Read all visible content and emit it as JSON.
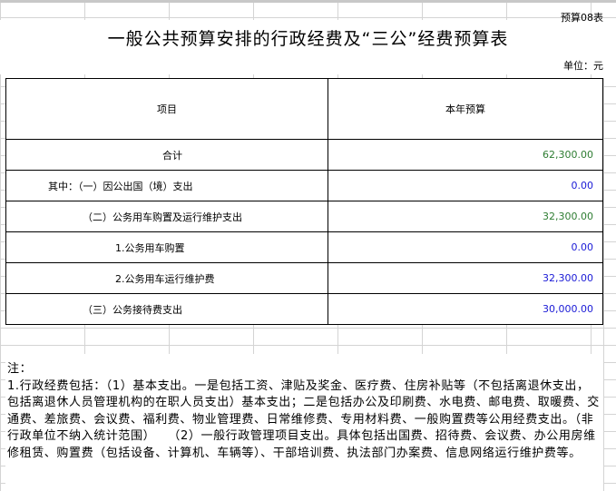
{
  "sheet": {
    "table_no": "预算08表",
    "title": "一般公共预算安排的行政经费及“三公”经费预算表",
    "unit": "单位：元"
  },
  "table": {
    "headers": [
      "项目",
      "本年预算"
    ],
    "rows": [
      {
        "label": "合计",
        "value": "62,300.00",
        "color": "#2e7d32"
      },
      {
        "label": "其中：（一）因公出国（境）支出",
        "value": "0.00",
        "color": "#1a1ad6"
      },
      {
        "label": "（二）公务用车购置及运行维护支出",
        "value": "32,300.00",
        "color": "#2e7d32"
      },
      {
        "label": "1.公务用车购置",
        "value": "0.00",
        "color": "#1a1ad6"
      },
      {
        "label": "2.公务用车运行维护费",
        "value": "32,300.00",
        "color": "#1a1ad6"
      },
      {
        "label": "（三）公务接待费支出",
        "value": "30,000.00",
        "color": "#1a1ad6"
      }
    ]
  },
  "notes": {
    "heading": "注：",
    "body": "1.行政经费包括：（1）基本支出。一是包括工资、津贴及奖金、医疗费、住房补贴等（不包括离退休支出，包括离退休人员管理机构的在职人员支出）基本支出；二是包括办公及印刷费、水电费、邮电费、取暖费、交通费、差旅费、会议费、福利费、物业管理费、日常维修费、专用材料费、一般购置费等公用经费支出。（非行政单位不纳入统计范围）　　（2）一般行政管理项目支出。具体包括出国费、招待费、会议费、办公用房维修租赁、购置费（包括设备、计算机、车辆等）、干部培训费、执法部门办案费、信息网络运行维护费等。"
  }
}
